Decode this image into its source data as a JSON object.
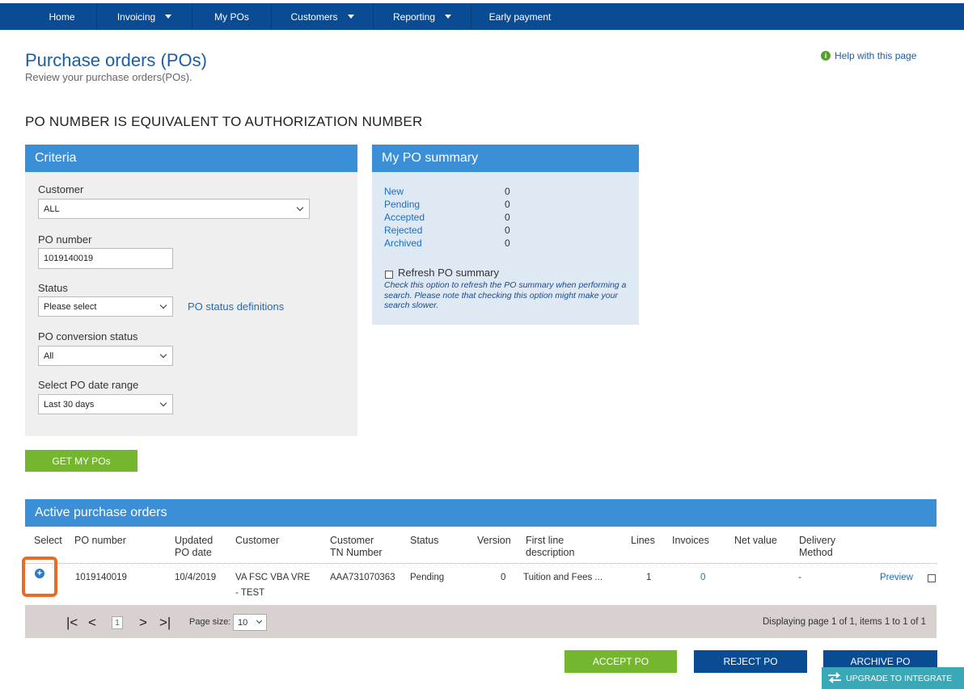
{
  "nav": {
    "items": [
      {
        "label": "Home",
        "caret": false
      },
      {
        "label": "Invoicing",
        "caret": true
      },
      {
        "label": "My POs",
        "caret": false
      },
      {
        "label": "Customers",
        "caret": true
      },
      {
        "label": "Reporting",
        "caret": true
      },
      {
        "label": "Early payment",
        "caret": false
      }
    ]
  },
  "header": {
    "title": "Purchase orders (POs)",
    "subtitle": "Review your purchase orders(POs).",
    "help": "Help with this page",
    "notice": "PO NUMBER IS EQUIVALENT TO AUTHORIZATION NUMBER"
  },
  "criteria": {
    "title": "Criteria",
    "customer_label": "Customer",
    "customer_value": "ALL",
    "po_number_label": "PO number",
    "po_number_value": "1019140019",
    "status_label": "Status",
    "status_value": "Please select",
    "status_link": "PO status definitions",
    "conversion_label": "PO conversion status",
    "conversion_value": "All",
    "date_range_label": "Select PO date range",
    "date_range_value": "Last 30 days",
    "submit": "GET MY POs"
  },
  "summary": {
    "title": "My PO summary",
    "rows": [
      {
        "label": "New",
        "value": "0"
      },
      {
        "label": "Pending",
        "value": "0"
      },
      {
        "label": "Accepted",
        "value": "0"
      },
      {
        "label": "Rejected",
        "value": "0"
      },
      {
        "label": "Archived",
        "value": "0"
      }
    ],
    "refresh_label": "Refresh PO summary",
    "refresh_note": "Check this option to refresh the PO summary when performing a search. Please note that checking this option might make your search slower."
  },
  "orders": {
    "title": "Active purchase orders",
    "columns": {
      "select": "Select",
      "po_number": "PO number",
      "updated_1": "Updated",
      "updated_2": "PO date",
      "customer": "Customer",
      "tn_1": "Customer",
      "tn_2": "TN Number",
      "status": "Status",
      "version": "Version",
      "first_line_1": "First line",
      "first_line_2": "description",
      "lines": "Lines",
      "invoices": "Invoices",
      "net_value": "Net value",
      "delivery_1": "Delivery",
      "delivery_2": "Method"
    },
    "row": {
      "po_number": "1019140019",
      "updated": "10/4/2019",
      "customer_1": "VA FSC VBA VRE",
      "customer_2": "- TEST",
      "tn_number": "AAA731070363",
      "status": "Pending",
      "version": "0",
      "first_line": "Tuition and Fees ...",
      "lines": "1",
      "invoices": "0",
      "delivery": "-",
      "preview": "Preview"
    }
  },
  "pager": {
    "page": "1",
    "page_size_label": "Page size:",
    "page_size": "10",
    "info": "Displaying page 1 of 1, items 1 to 1 of 1"
  },
  "actions": {
    "accept": "ACCEPT PO",
    "reject": "REJECT PO",
    "archive": "ARCHIVE PO",
    "upgrade": "UPGRADE TO INTEGRATE"
  },
  "colors": {
    "nav": "#0a4c93",
    "panel_header": "#3a8fd6",
    "green": "#74b72e",
    "highlight": "#ec6b24"
  }
}
